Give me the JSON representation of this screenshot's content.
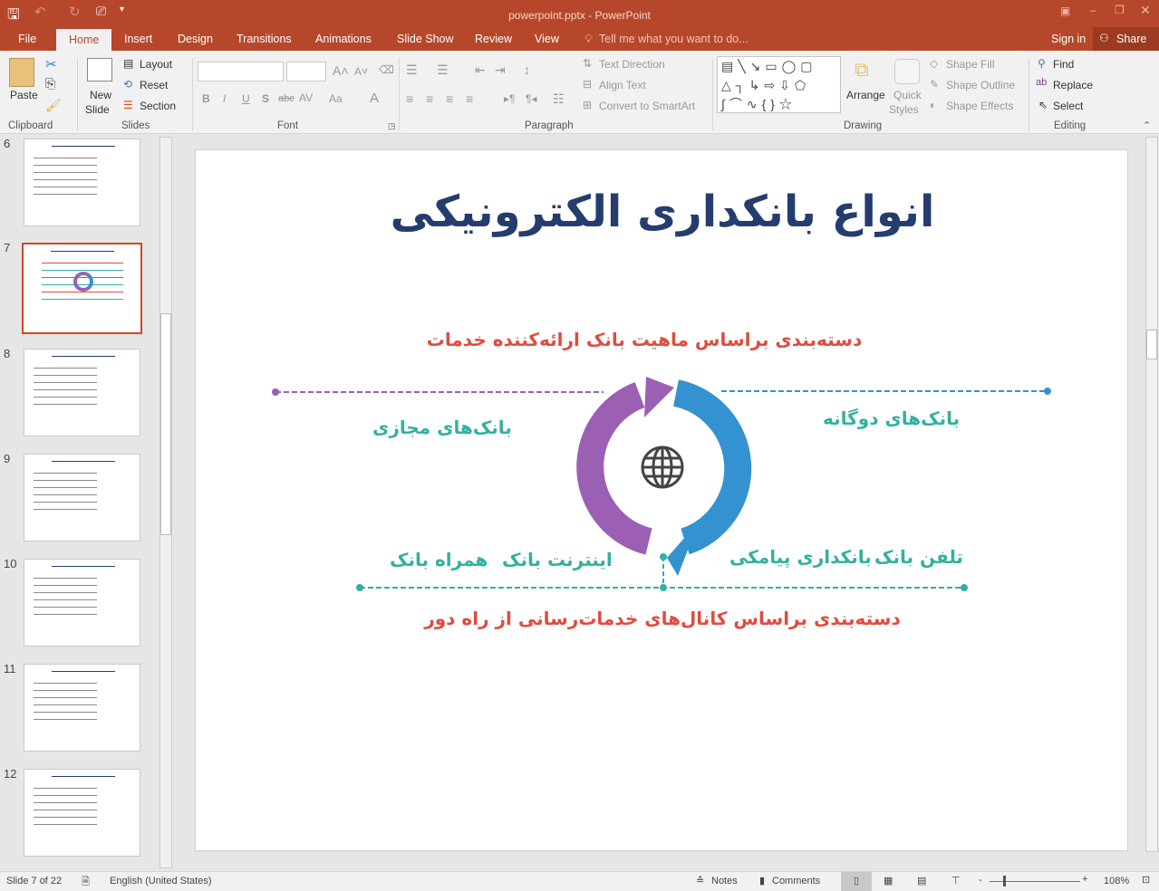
{
  "window": {
    "title": "powerpoint.pptx - PowerPoint"
  },
  "tabs": [
    "File",
    "Home",
    "Insert",
    "Design",
    "Transitions",
    "Animations",
    "Slide Show",
    "Review",
    "View"
  ],
  "active_tab": "Home",
  "tell_me": "Tell me what you want to do...",
  "sign_in": "Sign in",
  "share": "Share",
  "ribbon": {
    "clipboard": {
      "paste": "Paste",
      "group": "Clipboard"
    },
    "slides": {
      "new_slide_1": "New",
      "new_slide_2": "Slide",
      "layout": "Layout",
      "reset": "Reset",
      "section": "Section",
      "group": "Slides"
    },
    "font": {
      "group": "Font",
      "bold": "B",
      "italic": "I",
      "underline": "U",
      "shadow": "S",
      "strike": "abc",
      "spacing": "AV",
      "case": "Aa",
      "color": "A"
    },
    "paragraph": {
      "text_direction": "Text Direction",
      "align_text": "Align Text",
      "smartart": "Convert to SmartArt",
      "group": "Paragraph"
    },
    "drawing": {
      "arrange": "Arrange",
      "quick_styles_1": "Quick",
      "quick_styles_2": "Styles",
      "shape_fill": "Shape Fill",
      "shape_outline": "Shape Outline",
      "shape_effects": "Shape Effects",
      "group": "Drawing"
    },
    "editing": {
      "find": "Find",
      "replace": "Replace",
      "select": "Select",
      "group": "Editing"
    }
  },
  "thumbnails": [
    {
      "num": "6"
    },
    {
      "num": "7",
      "selected": true
    },
    {
      "num": "8"
    },
    {
      "num": "9"
    },
    {
      "num": "10"
    },
    {
      "num": "11"
    },
    {
      "num": "12"
    }
  ],
  "slide": {
    "title": "انواع بانکداری الکترونیکی",
    "top_heading": "دسته‌بندی براساس ماهیت بانک ارائه‌کننده خدمات",
    "bottom_heading": "دسته‌بندی براساس کانال‌های خدمات‌رسانی از راه دور",
    "virtual_banks": "بانک‌های مجازی",
    "dual_banks": "بانک‌های دوگانه",
    "mobile_bank": "همراه بانک",
    "internet_bank": "اینترنت بانک",
    "sms_banking": "بانکداری پیامکی",
    "telephone_bank": "تلفن بانک",
    "center_icon": "globe-icon",
    "colors": {
      "title": "#253d6e",
      "heading": "#e04b3f",
      "label": "#33b0a0",
      "purple": "#9b5fb4",
      "blue": "#3592d1",
      "teal": "#33b0a0"
    }
  },
  "status": {
    "slide": "Slide 7 of 22",
    "language": "English (United States)",
    "notes": "Notes",
    "comments": "Comments",
    "zoom": "108%",
    "zoom_percent": 108
  }
}
